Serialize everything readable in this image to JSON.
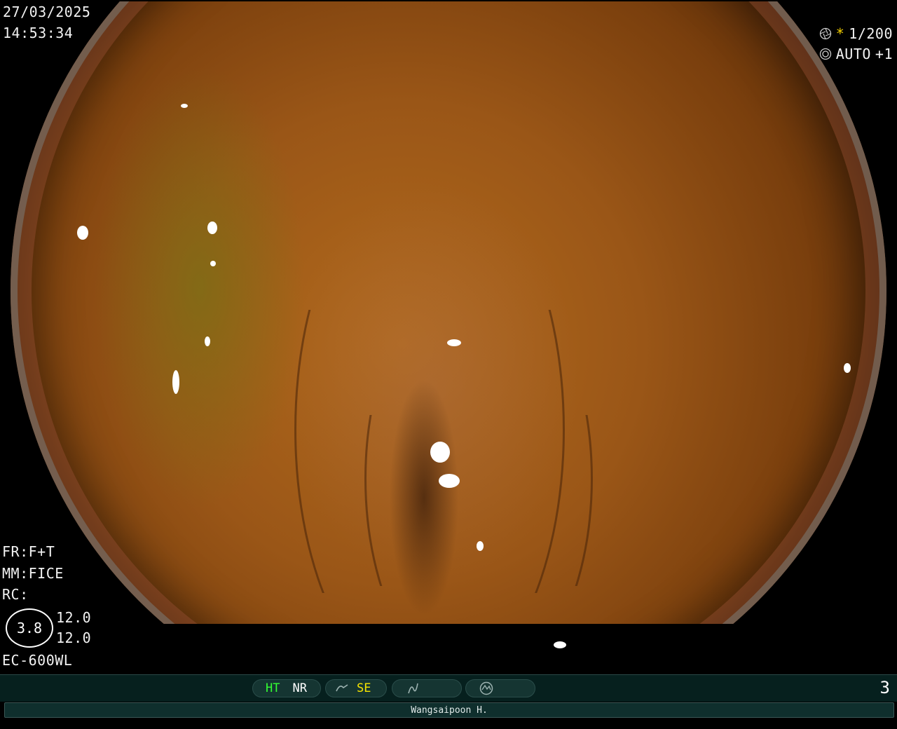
{
  "overlay": {
    "date": "27/03/2025",
    "time": "14:53:34",
    "shutter": "1/200",
    "shutter_mark": "*",
    "iris": "AUTO",
    "iris_level": "+1",
    "fr": "FR:F+T",
    "mm": "MM:FICE",
    "rc": "RC:",
    "circle_value": "3.8",
    "value_1": "12.0",
    "value_2": "12.0",
    "model": "EC-600WL"
  },
  "status_bar": {
    "ht": "HT",
    "nr": "NR",
    "se": "SE",
    "page": "3"
  },
  "footer": {
    "operator": "Wangsaipoon H."
  },
  "colors": {
    "ht": "#33ff33",
    "se": "#f5e400",
    "shutter_mark": "#f5d000",
    "bar_bg": "#06201e"
  },
  "icons": [
    "aperture-icon",
    "iris-icon",
    "enhance-icon",
    "filter-icon",
    "mode-icon"
  ]
}
